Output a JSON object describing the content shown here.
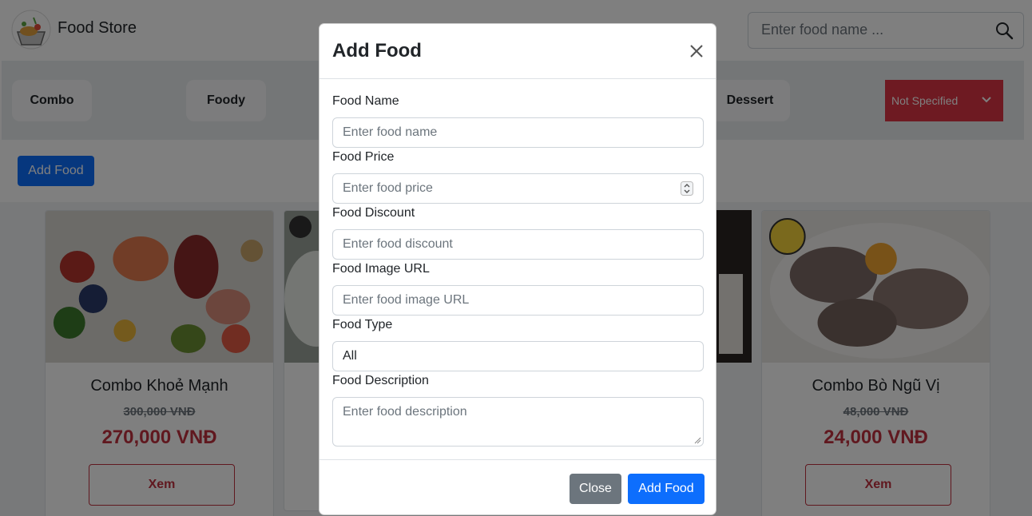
{
  "header": {
    "brand": "Food Store",
    "search_placeholder": "Enter food name ..."
  },
  "categories": {
    "combo": "Combo",
    "foody": "Foody",
    "dessert": "Dessert",
    "sort_selected": "Not Specified"
  },
  "toolbar": {
    "add_food_label": "Add Food"
  },
  "products": [
    {
      "name": "Combo Khoẻ Mạnh",
      "old_price": "300,000 VNĐ",
      "new_price": "270,000 VNĐ",
      "button": "Xem"
    },
    {
      "name": "Combo Bò Ngũ Vị",
      "old_price": "48,000 VNĐ",
      "new_price": "24,000 VNĐ",
      "button": "Xem"
    }
  ],
  "modal": {
    "title": "Add Food",
    "fields": {
      "name_label": "Food Name",
      "name_placeholder": "Enter food name",
      "price_label": "Food Price",
      "price_placeholder": "Enter food price",
      "discount_label": "Food Discount",
      "discount_placeholder": "Enter food discount",
      "image_label": "Food Image URL",
      "image_placeholder": "Enter food image URL",
      "type_label": "Food Type",
      "type_value": "All",
      "description_label": "Food Description",
      "description_placeholder": "Enter food description"
    },
    "close_label": "Close",
    "submit_label": "Add Food"
  },
  "colors": {
    "primary": "#0d6efd",
    "secondary": "#6c757d",
    "danger": "#dc3545",
    "price_red": "#c0303f"
  }
}
